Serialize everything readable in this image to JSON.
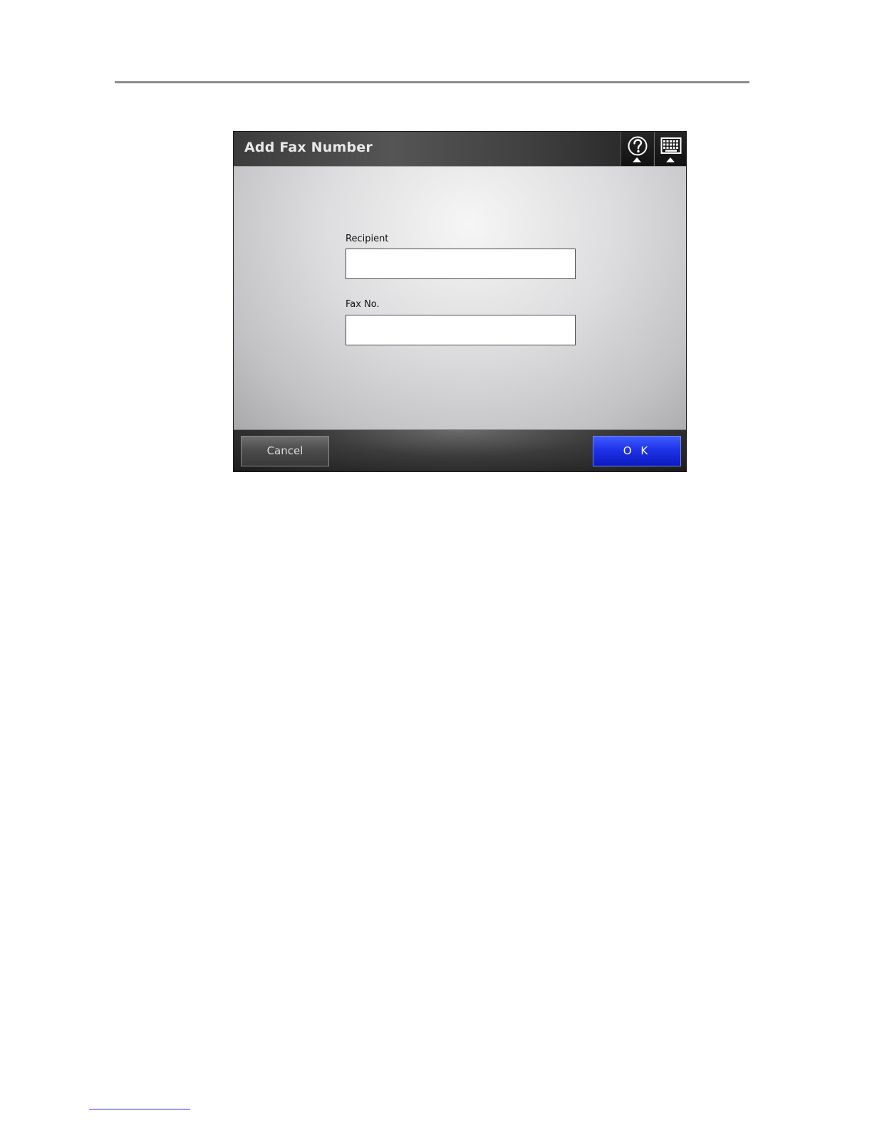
{
  "dialog": {
    "title": "Add Fax Number",
    "header_buttons": [
      {
        "icon": "help-icon"
      },
      {
        "icon": "keyboard-icon"
      }
    ]
  },
  "form": {
    "recipient": {
      "label": "Recipient",
      "value": ""
    },
    "fax_no": {
      "label": "Fax No.",
      "value": ""
    }
  },
  "footer": {
    "cancel_label": "Cancel",
    "ok_label": "O K"
  },
  "colors": {
    "ok_button": "#1e32e8",
    "title_text": "#e9e9e9"
  }
}
